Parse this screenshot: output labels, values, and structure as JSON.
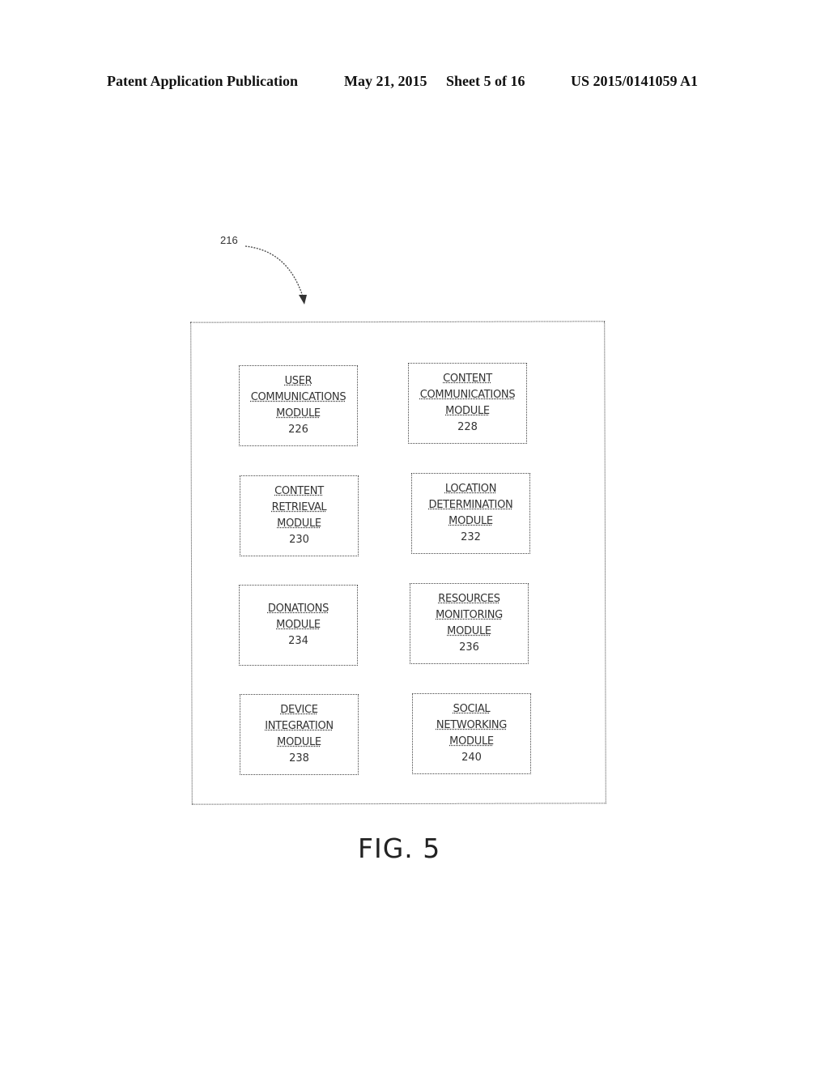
{
  "header": {
    "publication": "Patent Application Publication",
    "date": "May 21, 2015",
    "sheet": "Sheet 5 of 16",
    "number": "US 2015/0141059 A1"
  },
  "diagram": {
    "ref_label": "216",
    "modules": [
      {
        "lines": [
          "USER",
          "COMMUNICATIONS",
          "MODULE"
        ],
        "ref": "226"
      },
      {
        "lines": [
          "CONTENT",
          "COMMUNICATIONS",
          "MODULE"
        ],
        "ref": "228"
      },
      {
        "lines": [
          "CONTENT",
          "RETRIEVAL",
          "MODULE"
        ],
        "ref": "230"
      },
      {
        "lines": [
          "LOCATION",
          "DETERMINATION",
          "MODULE"
        ],
        "ref": "232"
      },
      {
        "lines": [
          "DONATIONS",
          "MODULE"
        ],
        "ref": "234"
      },
      {
        "lines": [
          "RESOURCES",
          "MONITORING",
          "MODULE"
        ],
        "ref": "236"
      },
      {
        "lines": [
          "DEVICE",
          "INTEGRATION",
          "MODULE"
        ],
        "ref": "238"
      },
      {
        "lines": [
          "SOCIAL",
          "NETWORKING",
          "MODULE"
        ],
        "ref": "240"
      }
    ],
    "figure_caption": "FIG. 5"
  }
}
